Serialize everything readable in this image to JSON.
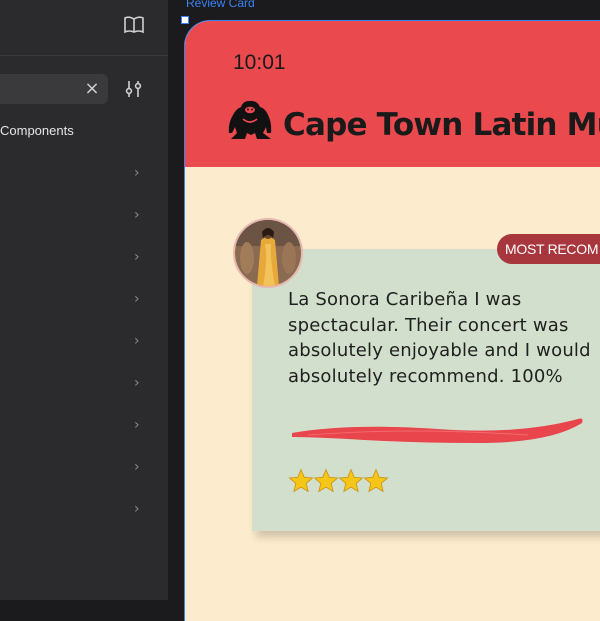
{
  "sidebar": {
    "search": {
      "value": ""
    },
    "section_label": "Components",
    "row_count": 9
  },
  "canvas": {
    "frame_label": "Review Card"
  },
  "phone": {
    "status_time": "10:01",
    "app_title": "Cape Town Latin Music",
    "header_color": "#ea4a4e",
    "background_color": "#fdebcd"
  },
  "review": {
    "badge": "MOST RECOM",
    "text": "La Sonora Caribeña I was spectacular. Their concert was absolutely enjoyable and I would absolutely recommend. 100%",
    "rating": 4,
    "max_rating": 4,
    "card_color": "#d3dfcd",
    "badge_color": "#a8373d"
  }
}
